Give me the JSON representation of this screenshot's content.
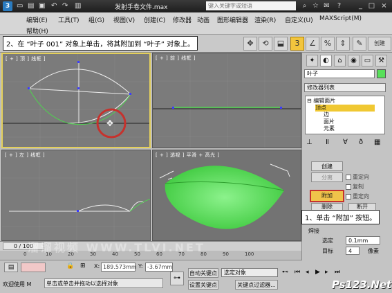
{
  "titlebar": {
    "title": "发射手卷文件.max",
    "search_placeholder": "键入关键字或短语"
  },
  "menu": {
    "items": [
      "编辑(E)",
      "工具(T)",
      "组(G)",
      "视图(V)",
      "创建(C)",
      "修改器",
      "动画",
      "图形编辑器",
      "渲染(R)",
      "自定义(U)",
      "MAXScript(M)",
      "帮助(H)"
    ]
  },
  "instructions": {
    "step2": "2、在 “叶子 001” 对象上单击，将其附加到 “叶子” 对象上。",
    "step1": "1、单击 “附加” 按钮。"
  },
  "viewports": {
    "top_label": "[ + ] 顶 ] 线框 ]",
    "front_label": "[ + ] 前 ] 线框 ]",
    "left_label": "[ + ] 左 ] 线框 ]",
    "persp_label": "[ + ] 透视 ] 平滑 + 高光 ]"
  },
  "cmdpanel": {
    "object_name": "叶子",
    "modifier_list": "修改器列表",
    "stack": [
      "编辑面片",
      "顶点",
      "边",
      "面片",
      "元素"
    ],
    "buttons": {
      "create": "创建",
      "detach": "分离",
      "attach": "附加",
      "delete": "删除",
      "break": "断开"
    },
    "checks": {
      "reorient": "重定向",
      "copy": "复制",
      "reorient2": "重定向"
    },
    "weld": "焊接",
    "selected_label": "选定",
    "selected_value": "0.1mm",
    "target_label": "目标",
    "target_value": "4",
    "pixels": "像素"
  },
  "timeline": {
    "counter": "0 / 100",
    "ticks": [
      "0",
      "10",
      "20",
      "30",
      "40",
      "50",
      "60",
      "70",
      "80",
      "90",
      "100"
    ]
  },
  "status": {
    "welcome": "欢迎使用 M",
    "hint": "单击或单击并拖动以选择对象",
    "x_label": "X:",
    "x_value": "189.573mm",
    "y_label": "Y:",
    "y_value": "-3.67mm",
    "autokey": "自动关键点",
    "setkey": "设置关键点",
    "selection_set": "选定对象",
    "keyfilter": "关键点过滤器..."
  },
  "watermark": "溜溜视频 WWW.TLVI.NET",
  "brand": "Ps123.Net",
  "colors": {
    "active_viewport": "#e3cf5a",
    "highlight": "#f0c832",
    "callout_ring": "#c6322d",
    "leaf_green": "#58e05a"
  }
}
